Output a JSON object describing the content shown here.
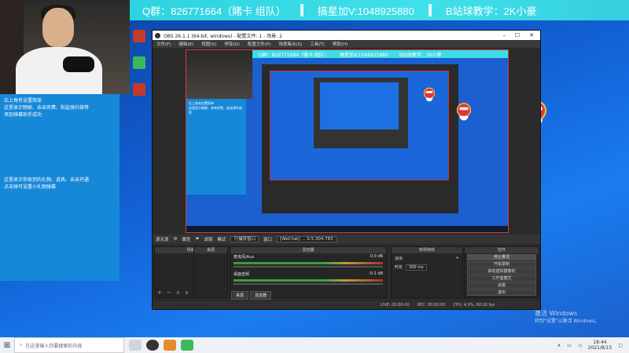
{
  "banner": {
    "qq_group": "Q群：826771664（賭卡 组队）",
    "contact": "搞星加V:1048925880",
    "bilibili": "B站球教学：2K小豪"
  },
  "overlay_left": {
    "lines_top": [
      "右上角有设置简单",
      "这里显示物联、亲亲房费、粘盐弹升级等",
      "添加弹幕助手成功"
    ],
    "lines_bottom": [
      "这里显示你收到的礼物、道具、亲亲开通",
      "点击弹可设置小礼物弹幕"
    ]
  },
  "desktop_icons": [
    {
      "name": "PUBG",
      "color": "#c73a2b"
    },
    {
      "name": "WeChat",
      "color": "#3cb95c"
    },
    {
      "name": "Nvidia GeForce",
      "color": "#c73a2b"
    }
  ],
  "obs": {
    "title": "OBS 26.1.1 (64-bit, windows) - 配置文件: 1 - 场景: 2",
    "menu": [
      "文件(F)",
      "编辑(E)",
      "视图(V)",
      "停靠(D)",
      "配置文件(P)",
      "场景集合(S)",
      "工具(T)",
      "帮助(H)"
    ],
    "source_toolbar": {
      "properties": "属性",
      "filters": "滤镜",
      "mode_label": "模式",
      "mode_value": "只捕获窗口",
      "window_label": "窗口",
      "window_value": "[WeChat] ... 0.5.304.783"
    },
    "sources_label": "源无源",
    "docks": {
      "scenes": "场景",
      "sources": "来源",
      "mixer": "混音器",
      "transitions": "转场特效",
      "controls": "控件"
    },
    "mixer_channels": [
      {
        "name": "麦克风/Aux",
        "db": "0.0 dB"
      },
      {
        "name": "桌面音频",
        "db": "-0.1 dB"
      }
    ],
    "transition": {
      "type": "淡出",
      "duration_label": "时长",
      "duration_value": "300 ms"
    },
    "controls": [
      "停止推流",
      "开始录制",
      "启动虚拟摄像机",
      "工作室模式",
      "设置",
      "退出"
    ],
    "scene_tabs": [
      "来源",
      "混音器"
    ],
    "status": {
      "live": "LIVE: 00:00:00",
      "rec": "REC: 00:00:00",
      "cpu": "CPU: 4.9%, 60.00 fps"
    }
  },
  "activation": {
    "title": "激活 Windows",
    "subtitle": "转到\"设置\"以激活 Windows。"
  },
  "taskbar": {
    "search_placeholder": "在这里输入你要搜索的内容",
    "time": "18:44",
    "date": "2021/8/15"
  }
}
